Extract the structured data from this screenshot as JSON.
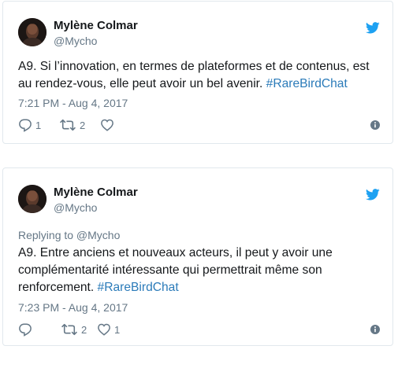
{
  "tweets": [
    {
      "author_name": "Mylène Colmar",
      "handle": "@Mycho",
      "replying_to": "",
      "text_before": "A9. Si l’innovation, en termes de plateformes et de contenus, est au rendez-vous, elle peut avoir un bel avenir. ",
      "hashtag": "#RareBirdChat",
      "timestamp": "7:21 PM - Aug 4, 2017",
      "reply_count": "1",
      "retweet_count": "2",
      "like_count": ""
    },
    {
      "author_name": "Mylène Colmar",
      "handle": "@Mycho",
      "replying_to": "Replying to @Mycho",
      "text_before": "A9. Entre anciens et nouveaux acteurs, il peut y avoir une complémentarité intéressante qui permettrait même son renforcement. ",
      "hashtag": "#RareBirdChat",
      "timestamp": "7:23 PM - Aug 4, 2017",
      "reply_count": "",
      "retweet_count": "2",
      "like_count": "1"
    }
  ],
  "colors": {
    "twitter_blue": "#1da1f2",
    "hashtag_blue": "#2b7bb9",
    "muted_gray": "#657786",
    "icon_gray": "#657786",
    "border": "#e1e8ed"
  },
  "icons": [
    "twitter-bird-icon",
    "reply-icon",
    "retweet-icon",
    "heart-icon",
    "info-icon"
  ]
}
